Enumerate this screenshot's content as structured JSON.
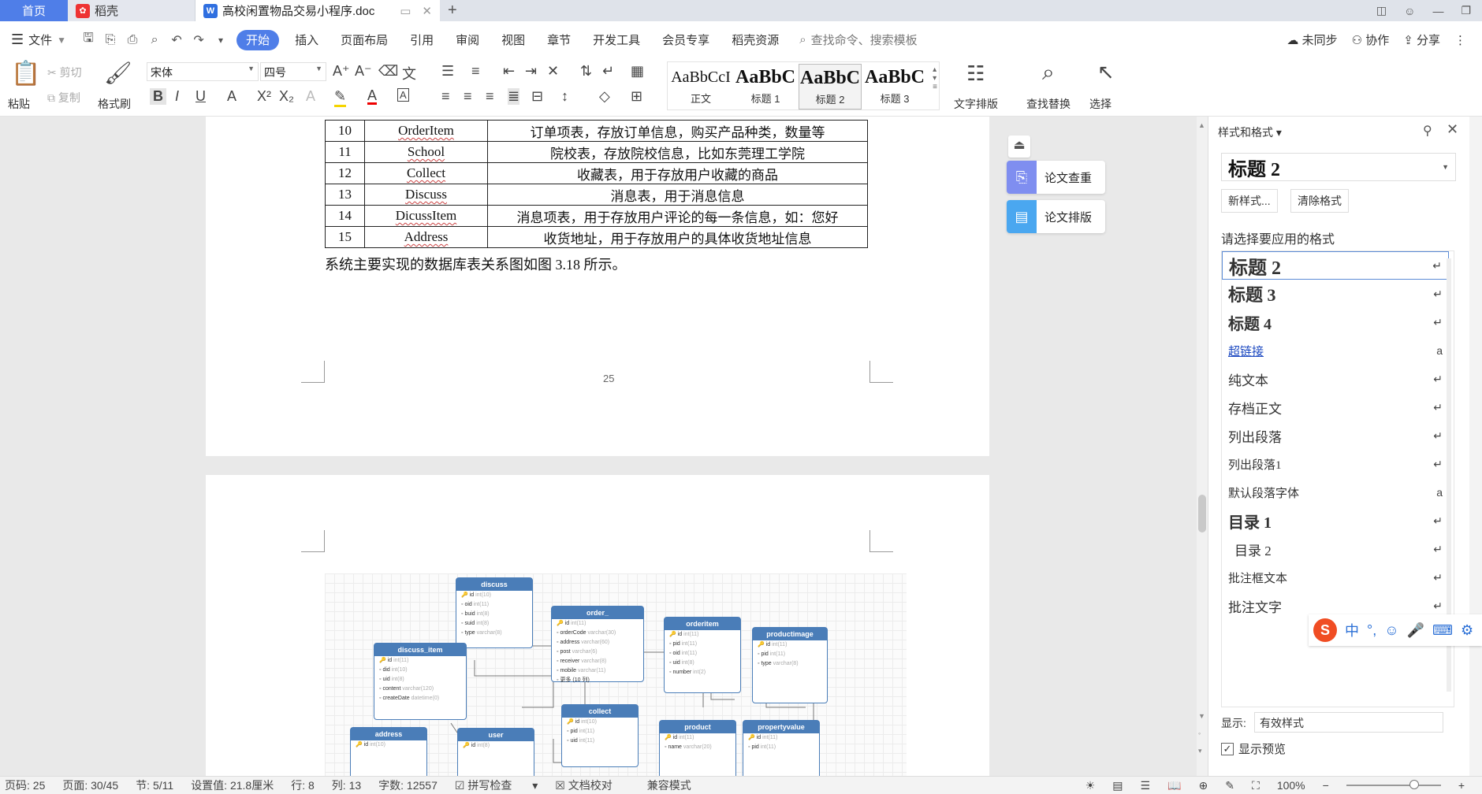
{
  "tabs": {
    "home": "首页",
    "daoke": "稻壳",
    "doc": "高校闲置物品交易小程序.doc",
    "new_tab": "+"
  },
  "menu": {
    "file": "文件",
    "items": [
      "开始",
      "插入",
      "页面布局",
      "引用",
      "审阅",
      "视图",
      "章节",
      "开发工具",
      "会员专享",
      "稻壳资源"
    ],
    "search": "查找命令、搜索模板",
    "sync": "未同步",
    "collab": "协作",
    "share": "分享"
  },
  "ribbon": {
    "paste": "粘贴",
    "cut": "剪切",
    "copy": "复制",
    "format_painter": "格式刷",
    "font": "宋体",
    "size": "四号",
    "bold": "B",
    "italic": "I",
    "underline": "U",
    "styles": [
      {
        "preview": "AaBbCcI",
        "name": "正文"
      },
      {
        "preview": "AaBbC",
        "name": "标题 1"
      },
      {
        "preview": "AaBbC",
        "name": "标题 2"
      },
      {
        "preview": "AaBbC",
        "name": "标题 3"
      }
    ],
    "text_layout": "文字排版",
    "find_replace": "查找替换",
    "select": "选择"
  },
  "doc": {
    "table_rows": [
      [
        "10",
        "OrderItem",
        "订单项表，存放订单信息，购买产品种类，数量等"
      ],
      [
        "11",
        "School",
        "院校表，存放院校信息，比如东莞理工学院"
      ],
      [
        "12",
        "Collect",
        "收藏表，用于存放用户收藏的商品"
      ],
      [
        "13",
        "Discuss",
        "消息表，用于消息信息"
      ],
      [
        "14",
        "DicussItem",
        "消息项表，用于存放用户评论的每一条信息，如：您好"
      ],
      [
        "15",
        "Address",
        "收货地址，用于存放用户的具体收货地址信息"
      ]
    ],
    "caption": "系统主要实现的数据库表关系图如图 3.18 所示。",
    "page_number": "25"
  },
  "er": {
    "discuss": {
      "title": "discuss",
      "fields": [
        [
          "id",
          "int(10)"
        ],
        [
          "oid",
          "int(11)"
        ],
        [
          "buid",
          "int(8)"
        ],
        [
          "suid",
          "int(8)"
        ],
        [
          "type",
          "varchar(8)"
        ]
      ]
    },
    "discuss_item": {
      "title": "discuss_item",
      "fields": [
        [
          "id",
          "int(11)"
        ],
        [
          "did",
          "int(10)"
        ],
        [
          "uid",
          "int(8)"
        ],
        [
          "content",
          "varchar(120)"
        ],
        [
          "createDate",
          "datetime(0)"
        ]
      ]
    },
    "order": {
      "title": "order_",
      "fields": [
        [
          "id",
          "int(11)"
        ],
        [
          "orderCode",
          "varchar(30)"
        ],
        [
          "address",
          "varchar(60)"
        ],
        [
          "post",
          "varchar(6)"
        ],
        [
          "receiver",
          "varchar(8)"
        ],
        [
          "mobile",
          "varchar(11)"
        ],
        [
          "更多 (10 列)",
          ""
        ]
      ]
    },
    "orderitem": {
      "title": "orderitem",
      "fields": [
        [
          "id",
          "int(11)"
        ],
        [
          "pid",
          "int(11)"
        ],
        [
          "oid",
          "int(11)"
        ],
        [
          "uid",
          "int(8)"
        ],
        [
          "number",
          "int(2)"
        ]
      ]
    },
    "productimage": {
      "title": "productimage",
      "fields": [
        [
          "id",
          "int(11)"
        ],
        [
          "pid",
          "int(11)"
        ],
        [
          "type",
          "varchar(8)"
        ]
      ]
    },
    "collect": {
      "title": "collect",
      "fields": [
        [
          "id",
          "int(10)"
        ],
        [
          "pid",
          "int(11)"
        ],
        [
          "uid",
          "int(11)"
        ]
      ]
    },
    "address": {
      "title": "address",
      "fields": [
        [
          "id",
          "int(10)"
        ]
      ]
    },
    "user": {
      "title": "user",
      "fields": [
        [
          "id",
          "int(8)"
        ]
      ]
    },
    "product": {
      "title": "product",
      "fields": [
        [
          "id",
          "int(11)"
        ],
        [
          "name",
          "varchar(20)"
        ]
      ]
    },
    "propertyvalue": {
      "title": "propertyvalue",
      "fields": [
        [
          "id",
          "int(11)"
        ],
        [
          "pid",
          "int(11)"
        ]
      ]
    }
  },
  "side": {
    "check": "论文查重",
    "layout": "论文排版"
  },
  "panel": {
    "title": "样式和格式",
    "current": "标题 2",
    "new_style": "新样式...",
    "clear_format": "清除格式",
    "prompt": "请选择要应用的格式",
    "items": [
      {
        "label": "标题 2",
        "mark": "↵"
      },
      {
        "label": "标题 3",
        "mark": "↵"
      },
      {
        "label": "标题 4",
        "mark": "↵"
      },
      {
        "label": "超链接",
        "mark": "a"
      },
      {
        "label": "纯文本",
        "mark": "↵"
      },
      {
        "label": "存档正文",
        "mark": "↵"
      },
      {
        "label": "列出段落",
        "mark": "↵"
      },
      {
        "label": "列出段落1",
        "mark": "↵"
      },
      {
        "label": "默认段落字体",
        "mark": "a"
      },
      {
        "label": "目录 1",
        "mark": "↵"
      },
      {
        "label": "目录 2",
        "mark": "↵"
      },
      {
        "label": "批注框文本",
        "mark": "↵"
      },
      {
        "label": "批注文字",
        "mark": "↵"
      }
    ],
    "show_label": "显示:",
    "show_value": "有效样式",
    "preview_label": "显示预览"
  },
  "status": {
    "page": "页码: 25",
    "pages": "页面: 30/45",
    "section": "节: 5/11",
    "setting": "设置值: 21.8厘米",
    "row": "行: 8",
    "col": "列: 13",
    "words": "字数: 12557",
    "spell": "拼写检查",
    "proof": "文档校对",
    "compat": "兼容模式",
    "zoom": "100%"
  },
  "ime": {
    "lang": "中"
  }
}
